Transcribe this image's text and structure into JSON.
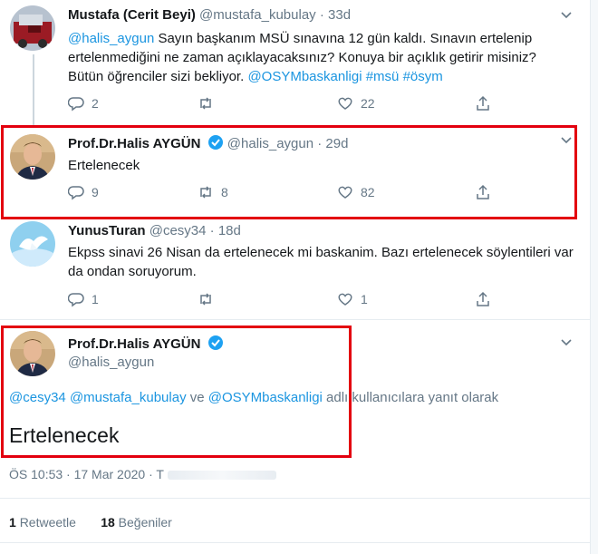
{
  "tweets": [
    {
      "name": "Mustafa (Cerit Beyi)",
      "handle": "@mustafa_kubulay",
      "dot": "·",
      "time": "33d",
      "text_parts": [
        "@halis_aygun",
        " Sayın başkanım MSÜ sınavına 12 gün kaldı. Sınavın ertelenip ertelenmediğini ne zaman açıklayacaksınız? Konuya bir açıklık getirir misiniz? Bütün öğrenciler sizi bekliyor. ",
        "@OSYMbaskanligi",
        " ",
        "#msü",
        " ",
        "#ösym"
      ],
      "replies": "2",
      "retweets": "",
      "likes": "22"
    },
    {
      "name": "Prof.Dr.Halis AYGÜN",
      "handle": "@halis_aygun",
      "dot": "·",
      "time": "29d",
      "text": "Ertelenecek",
      "replies": "9",
      "retweets": "8",
      "likes": "82"
    },
    {
      "name": "YunusTuran",
      "handle": "@cesy34",
      "dot": "·",
      "time": "18d",
      "text": "Ekpss sinavi 26 Nisan da ertelenecek mi baskanim. Bazı ertelenecek söylentileri var da ondan soruyorum.",
      "replies": "1",
      "retweets": "",
      "likes": "1"
    }
  ],
  "main": {
    "name": "Prof.Dr.Halis AYGÜN",
    "handle": "@halis_aygun",
    "reply_mentions": [
      "@cesy34",
      "@mustafa_kubulay",
      "@OSYMbaskanligi"
    ],
    "reply_ve": " ve ",
    "reply_suffix": " adlı kullanıcılara yanıt olarak",
    "text": "Ertelenecek",
    "time": "ÖS 10:53 · 17 Mar 2020 · T",
    "retweet_count": "1",
    "retweet_label": "Retweetle",
    "like_count": "18",
    "like_label": "Beğeniler"
  },
  "colors": {
    "link": "#1b95e0",
    "verified": "#1da1f2",
    "highlight": "#e3000f",
    "muted": "#657786"
  }
}
